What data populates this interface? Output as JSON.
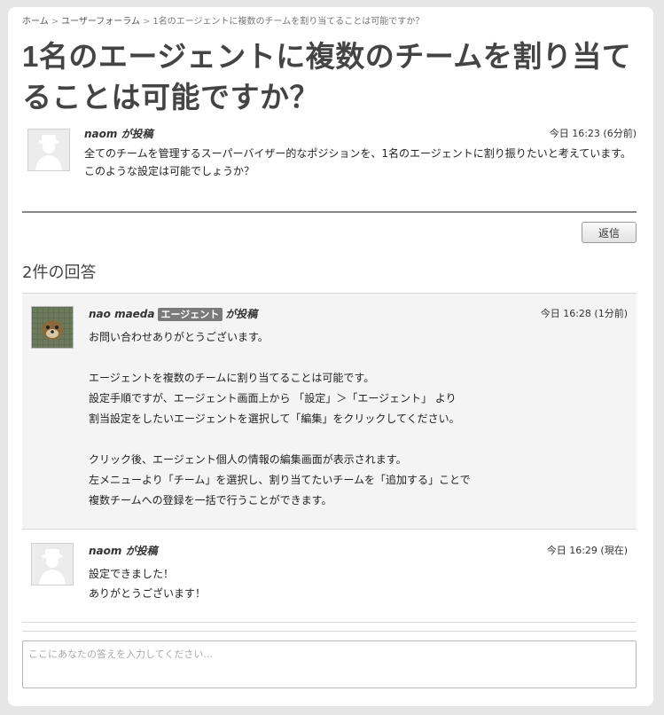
{
  "breadcrumb": {
    "home": "ホーム",
    "forum": "ユーザーフォーラム",
    "current": "1名のエージェントに複数のチームを割り当てることは可能ですか？",
    "separator": ">"
  },
  "topic": {
    "title": "1名のエージェントに複数のチームを割り当てることは可能ですか？",
    "author": "naom が投稿",
    "time": "今日 16:23 (6分前)",
    "body": [
      "全てのチームを管理するスーパーバイザー的なポジションを、1名のエージェントに割り振りたいと考えています。",
      "このような設定は可能でしょうか？"
    ]
  },
  "reply_button": "返信",
  "answers_heading": "2件の回答",
  "answers": [
    {
      "author_name": "nao maeda",
      "badge": "エージェント",
      "posted_suffix": "が投稿",
      "time": "今日 16:28 (1分前)",
      "body": [
        "お問い合わせありがとうございます。",
        "",
        "エージェントを複数のチームに割り当てることは可能です。",
        "設定手順ですが、エージェント画面上から 「設定」＞「エージェント」 より",
        "割当設定をしたいエージェントを選択して「編集」をクリックしてください。",
        "",
        "クリック後、エージェント個人の情報の編集画面が表示されます。",
        "左メニューより「チーム」を選択し、割り当てたいチームを「追加する」ことで",
        "複数チームへの登録を一括で行うことができます。"
      ]
    },
    {
      "author_name": "naom",
      "posted_suffix": "が投稿",
      "time": "今日 16:29 (現在)",
      "body": [
        "設定できました！",
        "ありがとうございます！"
      ]
    }
  ],
  "answer_input": {
    "placeholder": "ここにあなたの答えを入力してください..."
  }
}
